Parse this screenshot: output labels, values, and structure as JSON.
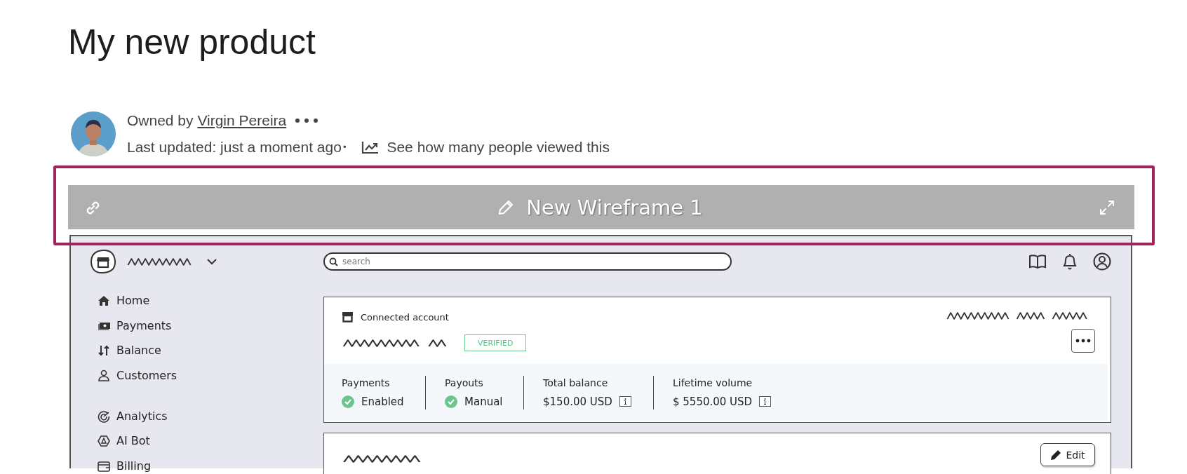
{
  "page": {
    "title": "My new product"
  },
  "meta": {
    "owner_prefix": "Owned by",
    "owner_name": "Virgin Pereira",
    "updated": "Last updated: just a moment ago",
    "separator": "•",
    "views_link": "See how many people viewed this"
  },
  "embed": {
    "title": "New Wireframe 1"
  },
  "wireframe": {
    "search": {
      "placeholder": "search"
    },
    "nav_groups": [
      {
        "items": [
          {
            "label": "Home",
            "kind": "home"
          },
          {
            "label": "Payments",
            "kind": "payments"
          },
          {
            "label": "Balance",
            "kind": "balance"
          },
          {
            "label": "Customers",
            "kind": "customers"
          }
        ]
      },
      {
        "items": [
          {
            "label": "Analytics",
            "kind": "analytics"
          },
          {
            "label": "AI Bot",
            "kind": "bot"
          },
          {
            "label": "Billing",
            "kind": "billing"
          }
        ]
      }
    ],
    "account_card": {
      "caption": "Connected account",
      "badge": "VERIFIED",
      "stats": [
        {
          "label": "Payments",
          "value": "Enabled",
          "kind": "status"
        },
        {
          "label": "Payouts",
          "value": "Manual",
          "kind": "status"
        },
        {
          "label": "Total balance",
          "value": "$150.00 USD",
          "kind": "amount"
        },
        {
          "label": "Lifetime volume",
          "value": "$ 5550.00 USD",
          "kind": "amount"
        }
      ]
    },
    "second_card": {
      "button": "Edit"
    }
  }
}
